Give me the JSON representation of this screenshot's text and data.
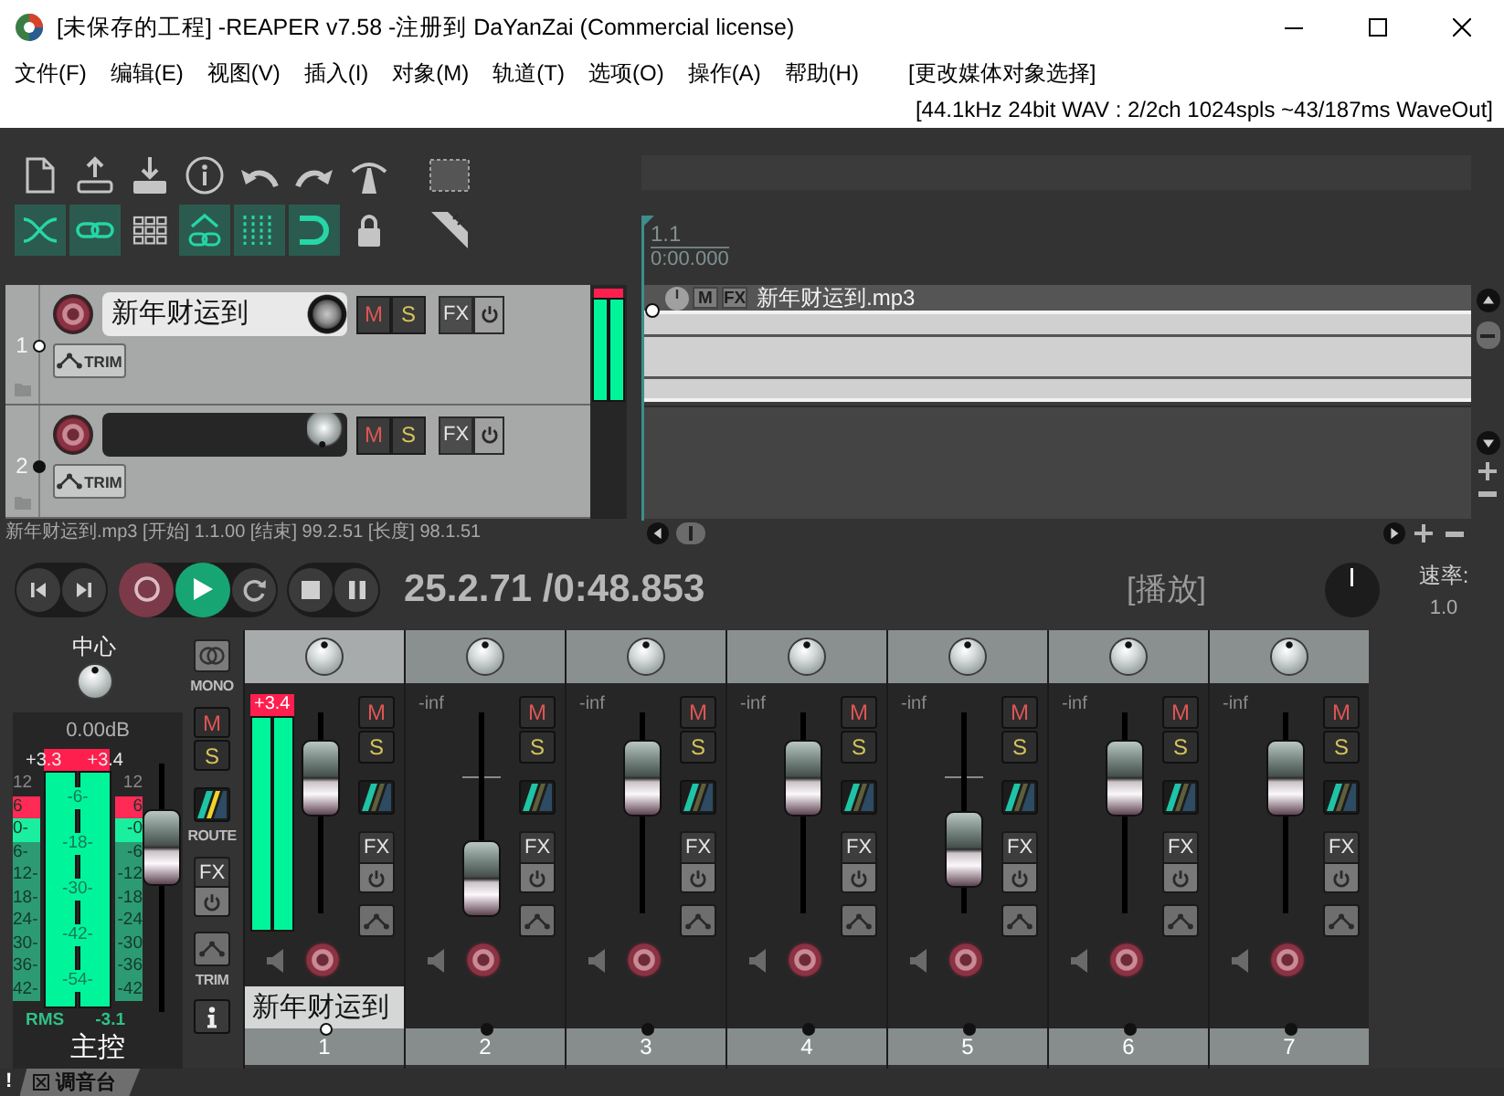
{
  "window": {
    "title": "[未保存的工程] -REAPER v7.58 -注册到 DaYanZai (Commercial license)"
  },
  "menu": [
    {
      "label": "文件(F)"
    },
    {
      "label": "编辑(E)"
    },
    {
      "label": "视图(V)"
    },
    {
      "label": "插入(I)"
    },
    {
      "label": "对象(M)"
    },
    {
      "label": "轨道(T)"
    },
    {
      "label": "选项(O)"
    },
    {
      "label": "操作(A)"
    },
    {
      "label": "帮助(H)"
    }
  ],
  "menu_status": "[更改媒体对象选择]",
  "audio_info": "[44.1kHz 24bit WAV : 2/2ch 1024spls ~43/187ms WaveOut]",
  "toolbar": {
    "toggles": [
      {
        "on": true
      },
      {
        "on": true
      },
      {
        "on": false
      },
      {
        "on": true
      },
      {
        "on": true
      },
      {
        "on": true
      },
      {
        "on": false
      },
      {
        "on": false
      }
    ]
  },
  "tracks": [
    {
      "number": "1",
      "name": "新年财运到",
      "selected": true,
      "mute": "M",
      "solo": "S",
      "fx": "FX",
      "trim": "TRIM",
      "meter": {
        "clipped": true,
        "channels": [
          {
            "level": 1
          },
          {
            "level": 1
          }
        ]
      }
    },
    {
      "number": "2",
      "selected": false,
      "mute": "M",
      "solo": "S",
      "fx": "FX",
      "trim": "TRIM"
    }
  ],
  "status_line": "新年财运到.mp3 [开始] 1.1.00 [结束] 99.2.51 [长度] 98.1.51",
  "ruler": {
    "bar": "1.1",
    "time": "0:00.000"
  },
  "item": {
    "name": "新年财运到.mp3",
    "mute": "M",
    "fx": "FX"
  },
  "transport": {
    "playing": true,
    "position": "25.2.71 /0:48.853",
    "state": "[播放]",
    "rate_label": "速率:",
    "rate": "1.0"
  },
  "master": {
    "pan": "中心",
    "volume": "0.00dB",
    "peak_left": "+3.3",
    "peak_right": "+3.4",
    "clipped": true,
    "meter": {
      "channels": [
        {
          "level": 1
        },
        {
          "level": 1
        }
      ]
    },
    "fader": {
      "level": 0.71
    },
    "scale_left": [
      {
        "label": "12"
      },
      {
        "label": "6",
        "color": "#ff2a55"
      },
      {
        "label": "0-",
        "color": "#19ef9f"
      },
      {
        "label": "6-",
        "color": "#2c9b73"
      },
      {
        "label": "12-",
        "color": "#2c9b73"
      },
      {
        "label": "18-",
        "color": "#2c9b73"
      },
      {
        "label": "24-",
        "color": "#2c9b73"
      },
      {
        "label": "30-",
        "color": "#2c9b73"
      },
      {
        "label": "36-",
        "color": "#2c9b73"
      },
      {
        "label": "42-",
        "color": "#2c9b73"
      }
    ],
    "scale_center": [
      "-6-",
      "-18-",
      "-30-",
      "-42-",
      "-54-"
    ],
    "scale_right": [
      {
        "label": "12"
      },
      {
        "label": "6",
        "color": "#ff2a55"
      },
      {
        "label": "-0",
        "color": "#19ef9f"
      },
      {
        "label": "-6",
        "color": "#2c9b73"
      },
      {
        "label": "-12",
        "color": "#2c9b73"
      },
      {
        "label": "-18",
        "color": "#2c9b73"
      },
      {
        "label": "-24",
        "color": "#2c9b73"
      },
      {
        "label": "-30",
        "color": "#2c9b73"
      },
      {
        "label": "-36",
        "color": "#2c9b73"
      },
      {
        "label": "-42",
        "color": "#2c9b73"
      }
    ],
    "rms_label": "RMS",
    "rms": "-3.1",
    "name": "主控",
    "mono": "MONO",
    "mute": "M",
    "solo": "S",
    "route": "ROUTE",
    "fx": "FX",
    "trim": "TRIM"
  },
  "mixer": {
    "strips": [
      {
        "number": "1",
        "name": "新年财运到",
        "selected": true,
        "peak": "+3.4",
        "clipped": true,
        "meter": {
          "channels": [
            {
              "level": 1
            },
            {
              "level": 1
            }
          ]
        },
        "fader": {
          "level": 0.74
        },
        "mute": "M",
        "solo": "S",
        "fx": "FX"
      },
      {
        "number": "2",
        "selected": false,
        "peak": "-inf",
        "clipped": false,
        "fader": {
          "level": 0.05
        },
        "mute": "M",
        "solo": "S",
        "fx": "FX"
      },
      {
        "number": "3",
        "selected": false,
        "peak": "-inf",
        "clipped": false,
        "fader": {
          "level": 0.74
        },
        "mute": "M",
        "solo": "S",
        "fx": "FX"
      },
      {
        "number": "4",
        "selected": false,
        "peak": "-inf",
        "clipped": false,
        "fader": {
          "level": 0.74
        },
        "mute": "M",
        "solo": "S",
        "fx": "FX"
      },
      {
        "number": "5",
        "selected": false,
        "peak": "-inf",
        "clipped": false,
        "fader": {
          "level": 0.25
        },
        "mute": "M",
        "solo": "S",
        "fx": "FX"
      },
      {
        "number": "6",
        "selected": false,
        "peak": "-inf",
        "clipped": false,
        "fader": {
          "level": 0.74
        },
        "mute": "M",
        "solo": "S",
        "fx": "FX"
      },
      {
        "number": "7",
        "selected": false,
        "peak": "-inf",
        "clipped": false,
        "fader": {
          "level": 0.74
        },
        "mute": "M",
        "solo": "S",
        "fx": "FX"
      }
    ]
  },
  "docker": {
    "alert": "!",
    "tab": "调音台"
  }
}
